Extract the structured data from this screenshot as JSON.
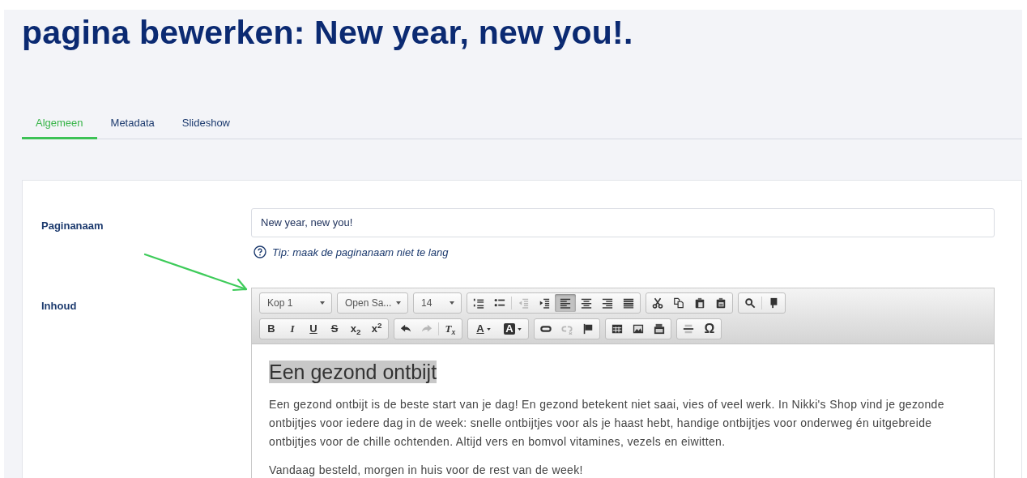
{
  "page_title": "pagina bewerken: New year, new you!.",
  "tabs": [
    {
      "label": "Algemeen",
      "selected": true
    },
    {
      "label": "Metadata",
      "selected": false
    },
    {
      "label": "Slideshow",
      "selected": false
    }
  ],
  "form": {
    "name_label": "Paginanaam",
    "name_value": "New year, new you!",
    "tip": "Tip: maak de paginanaam niet te lang",
    "content_label": "Inhoud"
  },
  "editor": {
    "toolbar_rows": [
      {
        "groups": [
          {
            "items": [
              {
                "kind": "dropdown",
                "label": "Kop 1"
              }
            ]
          },
          {
            "items": [
              {
                "kind": "dropdown",
                "label": "Open Sa..."
              }
            ]
          },
          {
            "items": [
              {
                "kind": "dropdown",
                "label": "14"
              }
            ]
          },
          {
            "items": [
              {
                "kind": "icon",
                "active": false,
                "disabled": false
              },
              {
                "kind": "icon",
                "active": false,
                "disabled": false
              },
              {
                "kind": "divider"
              },
              {
                "kind": "icon",
                "active": false,
                "disabled": true
              },
              {
                "kind": "icon",
                "active": false,
                "disabled": false
              },
              {
                "kind": "icon",
                "active": true,
                "disabled": false
              },
              {
                "kind": "icon",
                "active": false,
                "disabled": false
              },
              {
                "kind": "icon",
                "active": false,
                "disabled": false
              },
              {
                "kind": "icon",
                "active": false,
                "disabled": false
              }
            ]
          },
          {
            "items": [
              {
                "kind": "icon",
                "active": false,
                "disabled": false
              },
              {
                "kind": "icon",
                "active": false,
                "disabled": false
              },
              {
                "kind": "icon",
                "active": false,
                "disabled": false
              },
              {
                "kind": "icon",
                "active": false,
                "disabled": false
              }
            ]
          },
          {
            "items": [
              {
                "kind": "icon",
                "active": false,
                "disabled": false
              },
              {
                "kind": "divider"
              },
              {
                "kind": "icon",
                "active": false,
                "disabled": false
              }
            ]
          }
        ]
      },
      {
        "groups": [
          {
            "items": [
              {
                "kind": "glyph",
                "glyph": "B",
                "active": false,
                "disabled": false
              },
              {
                "kind": "glyph",
                "glyph": "I",
                "active": false,
                "disabled": false
              },
              {
                "kind": "glyph",
                "glyph": "U",
                "active": false,
                "disabled": false
              },
              {
                "kind": "glyph",
                "glyph": "S",
                "active": false,
                "disabled": false
              },
              {
                "kind": "glyph",
                "glyph": "x$_{2}$",
                "active": false,
                "disabled": false
              },
              {
                "kind": "glyph",
                "glyph": "x$^{2}$",
                "active": false,
                "disabled": false
              }
            ]
          },
          {
            "items": [
              {
                "kind": "icon",
                "active": false,
                "disabled": false
              },
              {
                "kind": "icon",
                "active": false,
                "disabled": true
              },
              {
                "kind": "divider"
              },
              {
                "kind": "glyph",
                "glyph": "T$_{x}$",
                "active": false,
                "disabled": false
              }
            ]
          },
          {
            "items": [
              {
                "kind": "color",
                "glyph": "A",
                "active": false,
                "disabled": false
              },
              {
                "kind": "color",
                "glyph": "A",
                "active": false,
                "disabled": false
              }
            ]
          },
          {
            "items": [
              {
                "kind": "icon",
                "active": false,
                "disabled": false
              },
              {
                "kind": "icon",
                "active": false,
                "disabled": true
              },
              {
                "kind": "icon",
                "active": false,
                "disabled": false
              }
            ]
          },
          {
            "items": [
              {
                "kind": "icon",
                "active": false,
                "disabled": false
              },
              {
                "kind": "icon",
                "active": false,
                "disabled": false
              },
              {
                "kind": "icon",
                "active": false,
                "disabled": false
              }
            ]
          },
          {
            "items": [
              {
                "kind": "icon",
                "active": false,
                "disabled": false
              },
              {
                "kind": "glyph",
                "glyph": "Ω",
                "active": false,
                "disabled": false
              }
            ]
          }
        ]
      }
    ],
    "content": [
      {
        "kind": "heading",
        "text": "Een gezond ontbijt",
        "highlighted": true
      },
      {
        "kind": "paragraph",
        "text": "Een gezond ontbijt is de beste start van je dag! En gezond betekent niet saai, vies of veel werk. In Nikki's Shop vind je gezonde ontbijtjes voor iedere dag in de week: snelle ontbijtjes voor als je haast hebt, handige ontbijtjes voor onderweg én uitgebreide ontbijtjes voor de chille ochtenden. Altijd vers en bomvol vitamines, vezels en eiwitten."
      },
      {
        "kind": "paragraph",
        "text": "Vandaag besteld, morgen in huis voor de rest van de week!"
      }
    ]
  }
}
